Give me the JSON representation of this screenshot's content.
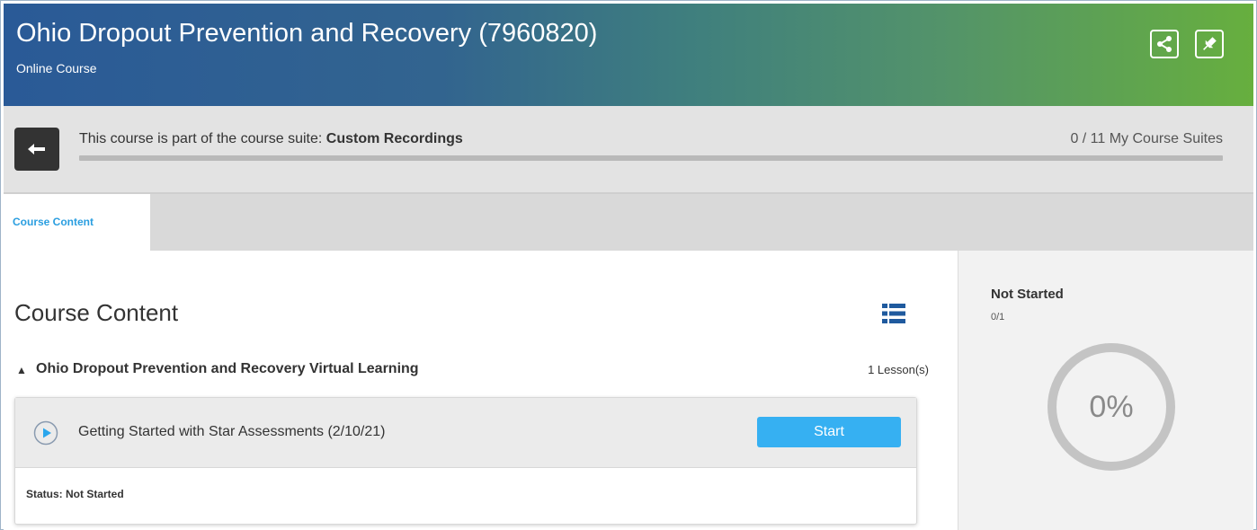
{
  "header": {
    "title": "Ohio Dropout Prevention and Recovery (7960820)",
    "subtitle": "Online Course",
    "share_icon": "share-icon",
    "pin_icon": "pin-icon"
  },
  "suite": {
    "prefix": "This course is part of the course suite: ",
    "name": "Custom Recordings",
    "count": "0 / 11 My Course Suites",
    "progress": 0,
    "back_icon": "back-arrow-icon"
  },
  "tabs": [
    {
      "label": "Course Content",
      "active": true
    }
  ],
  "content": {
    "title": "Course Content",
    "view_icon": "list-view-icon",
    "module": {
      "title": "Ohio Dropout Prevention and Recovery Virtual Learning",
      "lesson_count": "1 Lesson(s)",
      "expanded": true
    },
    "lesson": {
      "title": "Getting Started with Star Assessments (2/10/21)",
      "button": "Start",
      "status": "Status: Not Started",
      "icon": "play-circle-icon"
    }
  },
  "progress_panel": {
    "status": "Not Started",
    "count": "0/1",
    "percent_label": "0%",
    "percent": 0
  },
  "colors": {
    "banner_start": "#2a5a97",
    "banner_end": "#67af3e",
    "accent": "#36b0f2",
    "tab_text": "#2a9ee0",
    "icon_blue": "#1f5a9e"
  }
}
